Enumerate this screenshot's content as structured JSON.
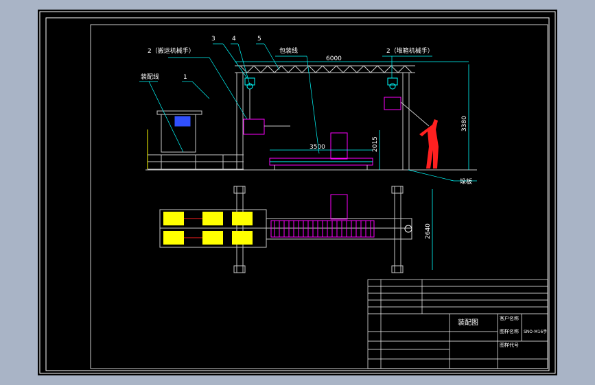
{
  "drawing": {
    "title": "装配图",
    "callouts": {
      "c2_left": "2（搬运机械手）",
      "c2_right": "2（堆箱机械手）",
      "c3": "3",
      "c4": "4",
      "c5": "5",
      "c1": "1",
      "assembly_line": "装配线",
      "packing_line": "包装线",
      "pallet": "垛板"
    },
    "dimensions": {
      "span": "6000",
      "height": "3380",
      "conveyor_length": "3500",
      "conveyor_height": "2015",
      "width_plan": "2640"
    },
    "title_block": {
      "client_label": "客户名称",
      "project_label": "图样名称",
      "drawing_no_label": "图样代号",
      "project_value": "SNO-M16手"
    }
  },
  "colors": {
    "frame": "#ffffff",
    "steel": "#c8c8c8",
    "cyan": "#00ffff",
    "magenta": "#ff00ff",
    "yellow": "#ffff00",
    "red": "#ff2020",
    "blue": "#3050ff",
    "green": "#00ff00"
  }
}
